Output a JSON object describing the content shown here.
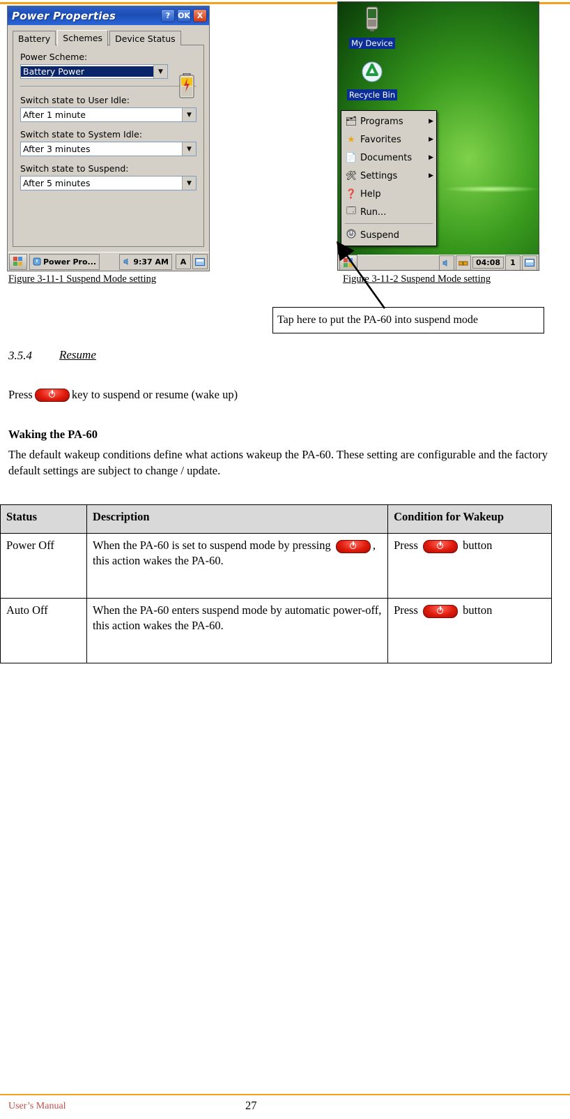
{
  "figure1": {
    "window_title": "Power Properties",
    "title_buttons": [
      "?",
      "OK",
      "X"
    ],
    "tabs": [
      "Battery",
      "Schemes",
      "Device Status"
    ],
    "active_tab": "Schemes",
    "fields": [
      {
        "label": "Power Scheme:",
        "value": "Battery Power",
        "selected": true
      },
      {
        "label": "Switch state to User Idle:",
        "value": "After 1 minute",
        "selected": false
      },
      {
        "label": "Switch state to System Idle:",
        "value": "After 3 minutes",
        "selected": false
      },
      {
        "label": "Switch state to Suspend:",
        "value": "After 5 minutes",
        "selected": false
      }
    ],
    "taskbar": {
      "task_label": "Power Pro...",
      "clock": "9:37 AM",
      "tray": [
        "A",
        "▣"
      ]
    },
    "caption": "Figure 3-11-1 Suspend Mode setting"
  },
  "figure2": {
    "desktop_icons": [
      {
        "label": "My Device",
        "icon": "device-icon"
      },
      {
        "label": "Recycle Bin",
        "icon": "recycle-icon"
      }
    ],
    "start_menu": [
      {
        "label": "Programs",
        "icon": "programs-icon",
        "submenu": true
      },
      {
        "label": "Favorites",
        "icon": "favorites-star-icon",
        "submenu": true
      },
      {
        "label": "Documents",
        "icon": "documents-icon",
        "submenu": true
      },
      {
        "label": "Settings",
        "icon": "settings-icon",
        "submenu": true
      },
      {
        "label": "Help",
        "icon": "help-icon",
        "submenu": false
      },
      {
        "label": "Run...",
        "icon": "run-icon",
        "submenu": false
      },
      {
        "label": "Suspend",
        "icon": "suspend-icon",
        "submenu": false
      }
    ],
    "taskbar": {
      "clock": "04:08",
      "tray_number": "1"
    },
    "caption": "Figure 3-11-2 Suspend Mode setting"
  },
  "callout": {
    "text": "Tap here to put the PA-60 into suspend mode"
  },
  "section": {
    "number": "3.5.4",
    "title": "Resume",
    "press_prefix": "Press",
    "press_suffix": "key to suspend or resume (wake up)",
    "heading": "Waking the PA-60",
    "paragraph": "The default wakeup conditions define what actions wakeup the PA-60. These setting are configurable and the factory default settings are subject to change / update."
  },
  "table": {
    "headers": [
      "Status",
      "Description",
      "Condition for Wakeup"
    ],
    "rows": [
      {
        "status": "Power Off",
        "description_before": "When the PA-60 is set to suspend mode by pressing",
        "description_after": ", this action wakes the PA-60.",
        "condition_before": "Press",
        "condition_after": "button"
      },
      {
        "status": "Auto Off",
        "description_before": "When the PA-60 enters suspend mode by automatic power-off, this action wakes the PA-60.",
        "description_after": "",
        "condition_before": "Press",
        "condition_after": "button"
      }
    ]
  },
  "footer": {
    "left": "User’s Manual",
    "page": "27"
  },
  "colors": {
    "rule": "#F6A01A",
    "title_bar": "#1B4DB5",
    "table_header_bg": "#D9D9D9",
    "power_key_red": "#E01B0C",
    "footer_text": "#C0504D"
  }
}
